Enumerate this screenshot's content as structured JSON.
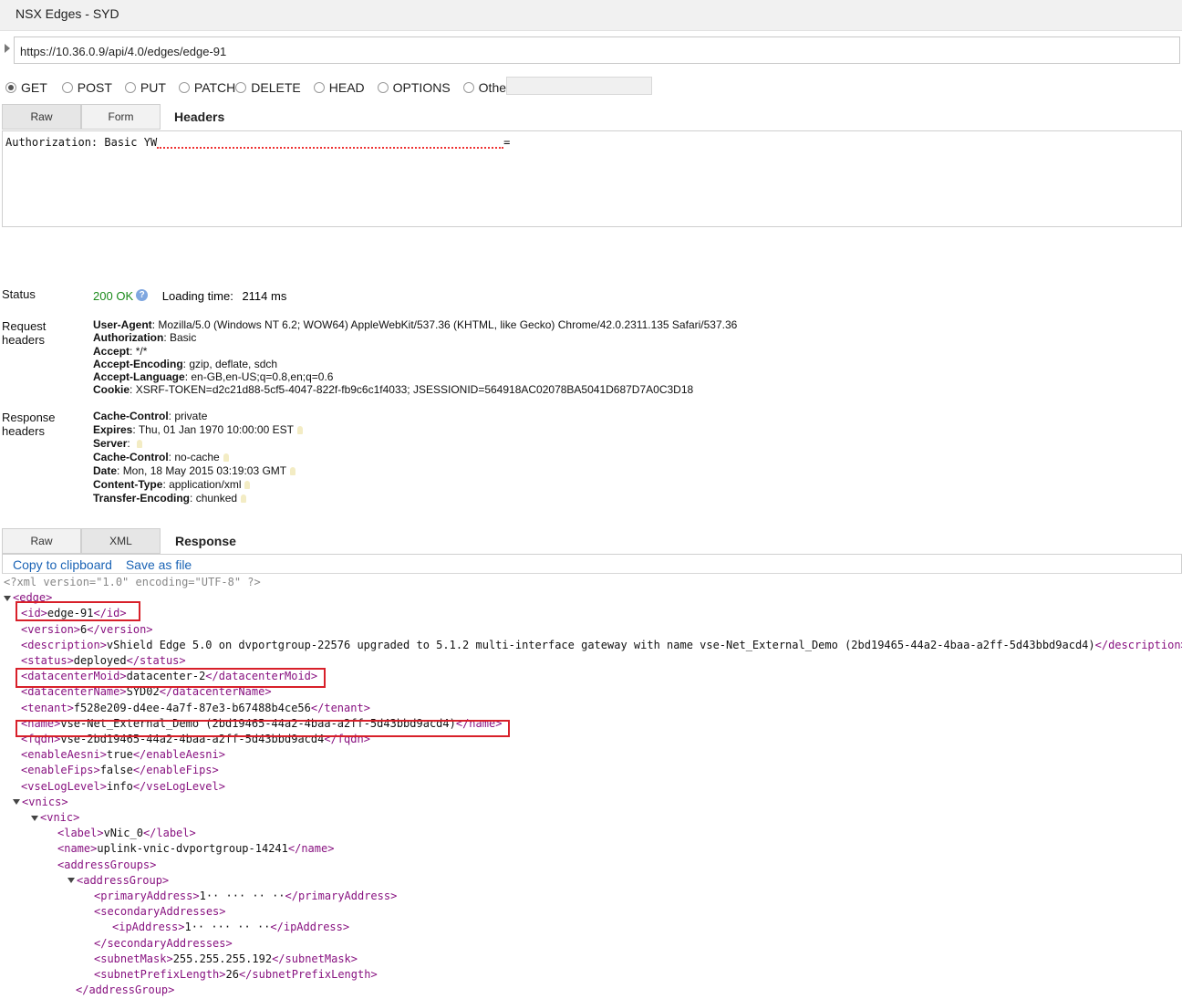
{
  "window": {
    "title": "NSX Edges - SYD"
  },
  "request": {
    "url": "https://10.36.0.9/api/4.0/edges/edge-91"
  },
  "methods": [
    {
      "label": "GET",
      "selected": true
    },
    {
      "label": "POST",
      "selected": false
    },
    {
      "label": "PUT",
      "selected": false
    },
    {
      "label": "PATCH",
      "selected": false
    },
    {
      "label": "DELETE",
      "selected": false
    },
    {
      "label": "HEAD",
      "selected": false
    },
    {
      "label": "OPTIONS",
      "selected": false
    },
    {
      "label": "Other",
      "selected": false
    }
  ],
  "request_tabs": {
    "raw": "Raw",
    "form": "Form",
    "title": "Headers"
  },
  "request_headers_text": "Authorization: Basic YW",
  "request_headers_tail": "=",
  "status": {
    "label": "Status",
    "code": "200",
    "text": "OK",
    "loading_label": "Loading time:",
    "loading_value": "2114 ms"
  },
  "request_headers": {
    "label": "Request headers",
    "items": [
      {
        "name": "User-Agent",
        "value": "Mozilla/5.0 (Windows NT 6.2; WOW64) AppleWebKit/537.36 (KHTML, like Gecko) Chrome/42.0.2311.135 Safari/537.36"
      },
      {
        "name": "Authorization",
        "value": "Basic"
      },
      {
        "name": "Accept",
        "value": "*/*"
      },
      {
        "name": "Accept-Encoding",
        "value": "gzip, deflate, sdch"
      },
      {
        "name": "Accept-Language",
        "value": "en-GB,en-US;q=0.8,en;q=0.6"
      },
      {
        "name": "Cookie",
        "value": "XSRF-TOKEN=d2c21d88-5cf5-4047-822f-fb9c6c1f4033; JSESSIONID=564918AC02078BA5041D687D7A0C3D18"
      }
    ]
  },
  "response_headers": {
    "label": "Response headers",
    "items": [
      {
        "name": "Cache-Control",
        "value": "private"
      },
      {
        "name": "Expires",
        "value": "Thu, 01 Jan 1970 10:00:00 EST"
      },
      {
        "name": "Server",
        "value": ""
      },
      {
        "name": "Cache-Control",
        "value": "no-cache"
      },
      {
        "name": "Date",
        "value": "Mon, 18 May 2015 03:19:03 GMT"
      },
      {
        "name": "Content-Type",
        "value": "application/xml"
      },
      {
        "name": "Transfer-Encoding",
        "value": "chunked"
      }
    ]
  },
  "response_tabs": {
    "raw": "Raw",
    "xml": "XML",
    "title": "Response"
  },
  "response_actions": {
    "copy": "Copy to clipboard",
    "save": "Save as file"
  },
  "xml_lines": [
    {
      "indent": 0,
      "decl": "<?xml version=\"1.0\" encoding=\"UTF-8\" ?>"
    },
    {
      "indent": 0,
      "toggle": true,
      "open": "edge"
    },
    {
      "indent": 1,
      "tag": "id",
      "value": "edge-91"
    },
    {
      "indent": 1,
      "tag": "version",
      "value": "6"
    },
    {
      "indent": 1,
      "tag": "description",
      "value": "vShield Edge 5.0 on dvportgroup-22576 upgraded to 5.1.2 multi-interface gateway with name vse-Net_External_Demo (2bd19465-44a2-4baa-a2ff-5d43bbd9acd4)"
    },
    {
      "indent": 1,
      "tag": "status",
      "value": "deployed"
    },
    {
      "indent": 1,
      "tag": "datacenterMoid",
      "value": "datacenter-2"
    },
    {
      "indent": 1,
      "tag": "datacenterName",
      "value": "SYD02"
    },
    {
      "indent": 1,
      "tag": "tenant",
      "value": "f528e209-d4ee-4a7f-87e3-b67488b4ce56"
    },
    {
      "indent": 1,
      "tag": "name",
      "value": "vse-Net_External_Demo (2bd19465-44a2-4baa-a2ff-5d43bbd9acd4)"
    },
    {
      "indent": 1,
      "tag": "fqdn",
      "value": "vse-2bd19465-44a2-4baa-a2ff-5d43bbd9acd4"
    },
    {
      "indent": 1,
      "tag": "enableAesni",
      "value": "true"
    },
    {
      "indent": 1,
      "tag": "enableFips",
      "value": "false"
    },
    {
      "indent": 1,
      "tag": "vseLogLevel",
      "value": "info"
    },
    {
      "indent": 1,
      "toggle": true,
      "open": "vnics"
    },
    {
      "indent": 2,
      "toggle": true,
      "open": "vnic"
    },
    {
      "indent": 3,
      "tag": "label",
      "value": "vNic_0"
    },
    {
      "indent": 3,
      "tag": "name",
      "value": "uplink-vnic-dvportgroup-14241"
    },
    {
      "indent": 3,
      "open": "addressGroups"
    },
    {
      "indent": 4,
      "toggle": true,
      "open": "addressGroup"
    },
    {
      "indent": 5,
      "tag": "primaryAddress",
      "value": "1·· ··· ·· ··"
    },
    {
      "indent": 5,
      "open": "secondaryAddresses"
    },
    {
      "indent": 6,
      "tag": "ipAddress",
      "value": "1·· ··· ·· ··"
    },
    {
      "indent": 5,
      "close": "secondaryAddresses"
    },
    {
      "indent": 5,
      "tag": "subnetMask",
      "value": "255.255.255.192"
    },
    {
      "indent": 5,
      "tag": "subnetPrefixLength",
      "value": "26"
    },
    {
      "indent": 4,
      "close": "addressGroup"
    }
  ],
  "colors": {
    "highlight_box": "#d8202a",
    "xml_tag": "#881280",
    "link": "#1a63b5",
    "status_ok": "#1a8a1a"
  }
}
